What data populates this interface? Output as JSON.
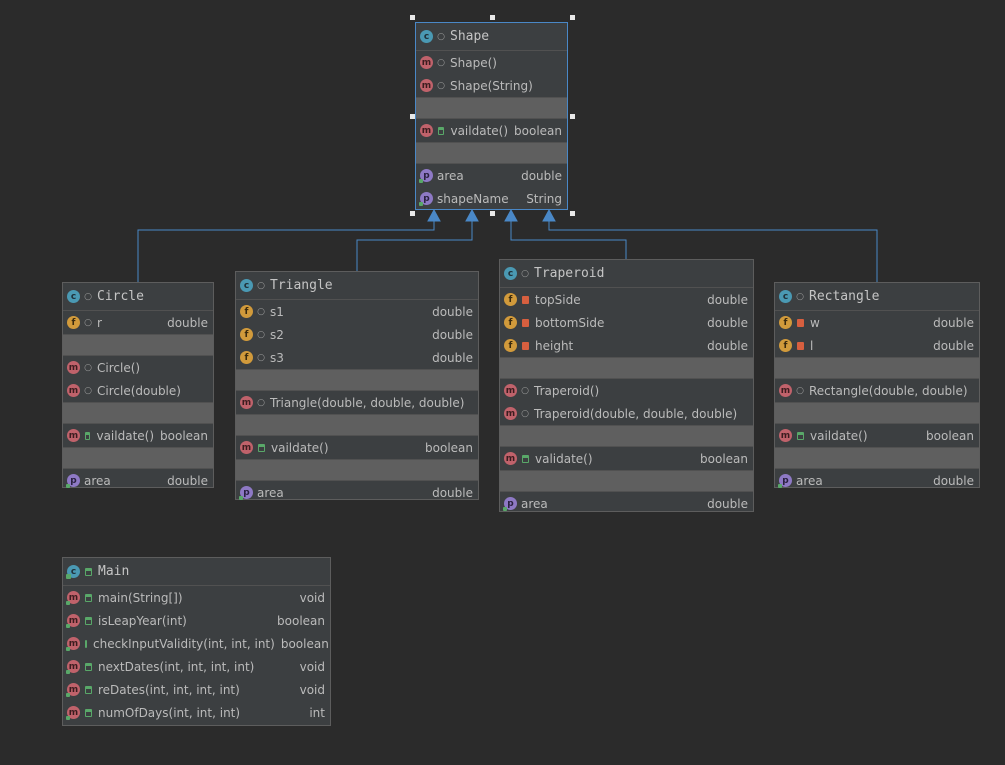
{
  "diagram": {
    "classes": {
      "shape": {
        "name": "Shape",
        "constructors": [
          {
            "name": "Shape()",
            "type": ""
          },
          {
            "name": "Shape(String)",
            "type": ""
          }
        ],
        "methods": [
          {
            "name": "vaildate()",
            "type": "boolean"
          }
        ],
        "properties": [
          {
            "name": "area",
            "type": "double"
          },
          {
            "name": "shapeName",
            "type": "String"
          }
        ]
      },
      "circle": {
        "name": "Circle",
        "fields": [
          {
            "name": "r",
            "type": "double"
          }
        ],
        "constructors": [
          {
            "name": "Circle()",
            "type": ""
          },
          {
            "name": "Circle(double)",
            "type": ""
          }
        ],
        "methods": [
          {
            "name": "vaildate()",
            "type": "boolean"
          }
        ],
        "properties": [
          {
            "name": "area",
            "type": "double"
          }
        ]
      },
      "triangle": {
        "name": "Triangle",
        "fields": [
          {
            "name": "s1",
            "type": "double"
          },
          {
            "name": "s2",
            "type": "double"
          },
          {
            "name": "s3",
            "type": "double"
          }
        ],
        "constructors": [
          {
            "name": "Triangle(double, double, double)",
            "type": ""
          }
        ],
        "methods": [
          {
            "name": "vaildate()",
            "type": "boolean"
          }
        ],
        "properties": [
          {
            "name": "area",
            "type": "double"
          }
        ]
      },
      "traperoid": {
        "name": "Traperoid",
        "fields": [
          {
            "name": "topSide",
            "type": "double"
          },
          {
            "name": "bottomSide",
            "type": "double"
          },
          {
            "name": "height",
            "type": "double"
          }
        ],
        "constructors": [
          {
            "name": "Traperoid()",
            "type": ""
          },
          {
            "name": "Traperoid(double, double, double)",
            "type": ""
          }
        ],
        "methods": [
          {
            "name": "validate()",
            "type": "boolean"
          }
        ],
        "properties": [
          {
            "name": "area",
            "type": "double"
          }
        ]
      },
      "rectangle": {
        "name": "Rectangle",
        "fields": [
          {
            "name": "w",
            "type": "double"
          },
          {
            "name": "l",
            "type": "double"
          }
        ],
        "constructors": [
          {
            "name": "Rectangle(double, double)",
            "type": ""
          }
        ],
        "methods": [
          {
            "name": "vaildate()",
            "type": "boolean"
          }
        ],
        "properties": [
          {
            "name": "area",
            "type": "double"
          }
        ]
      },
      "main": {
        "name": "Main",
        "methods": [
          {
            "name": "main(String[])",
            "type": "void"
          },
          {
            "name": "isLeapYear(int)",
            "type": "boolean"
          },
          {
            "name": "checkInputValidity(int, int, int)",
            "type": "boolean"
          },
          {
            "name": "nextDates(int, int, int, int)",
            "type": "void"
          },
          {
            "name": "reDates(int, int, int, int)",
            "type": "void"
          },
          {
            "name": "numOfDays(int, int, int)",
            "type": "int"
          }
        ]
      }
    },
    "badges": {
      "class": "c",
      "method": "m",
      "field": "f",
      "property": "p"
    },
    "colors": {
      "background": "#2b2b2b",
      "node": "#3c3f41",
      "inheritance_edge": "#4a88c7",
      "selection": "#4a88c7"
    }
  }
}
